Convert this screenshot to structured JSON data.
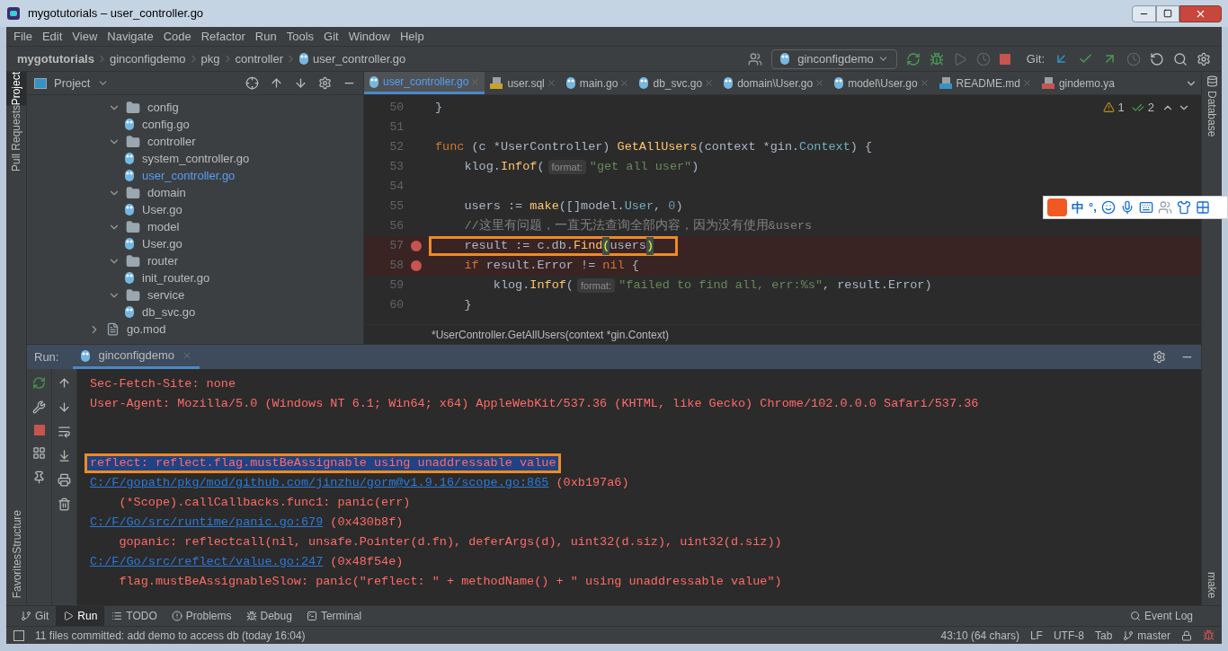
{
  "window": {
    "title": "mygotutorials – user_controller.go"
  },
  "menu": [
    "File",
    "Edit",
    "View",
    "Navigate",
    "Code",
    "Refactor",
    "Run",
    "Tools",
    "Git",
    "Window",
    "Help"
  ],
  "breadcrumb": [
    "mygotutorials",
    "ginconfigdemo",
    "pkg",
    "controller",
    "user_controller.go"
  ],
  "toolbar": {
    "run_config": "ginconfigdemo",
    "git_label": "Git:"
  },
  "left_strip": [
    {
      "label": "Project",
      "selected": true
    },
    {
      "label": "Pull Requests",
      "selected": false
    },
    {
      "label": "Structure",
      "selected": false
    },
    {
      "label": "Favorites",
      "selected": false
    }
  ],
  "project_panel": {
    "title": "Project",
    "tree": [
      {
        "label": "config",
        "kind": "folder",
        "expanded": true,
        "selected": false,
        "children": [
          {
            "label": "config.go",
            "kind": "go",
            "selected": false
          }
        ]
      },
      {
        "label": "controller",
        "kind": "folder",
        "expanded": true,
        "selected": false,
        "children": [
          {
            "label": "system_controller.go",
            "kind": "go",
            "selected": false
          },
          {
            "label": "user_controller.go",
            "kind": "go",
            "selected": true
          }
        ]
      },
      {
        "label": "domain",
        "kind": "folder",
        "expanded": true,
        "selected": false,
        "children": [
          {
            "label": "User.go",
            "kind": "go",
            "selected": false
          }
        ]
      },
      {
        "label": "model",
        "kind": "folder",
        "expanded": true,
        "selected": false,
        "children": [
          {
            "label": "User.go",
            "kind": "go",
            "selected": false
          }
        ]
      },
      {
        "label": "router",
        "kind": "folder",
        "expanded": true,
        "selected": false,
        "children": [
          {
            "label": "init_router.go",
            "kind": "go",
            "selected": false
          }
        ]
      },
      {
        "label": "service",
        "kind": "folder",
        "expanded": true,
        "selected": false,
        "children": [
          {
            "label": "db_svc.go",
            "kind": "go",
            "selected": false
          }
        ]
      },
      {
        "label": "go.mod",
        "kind": "mod",
        "expanded": false,
        "selected": false
      }
    ]
  },
  "editor_tabs": [
    {
      "label": "user_controller.go",
      "kind": "go",
      "selected": true
    },
    {
      "label": "user.sql",
      "kind": "sql",
      "selected": false
    },
    {
      "label": "main.go",
      "kind": "go",
      "selected": false
    },
    {
      "label": "db_svc.go",
      "kind": "go",
      "selected": false
    },
    {
      "label": "domain\\User.go",
      "kind": "go",
      "selected": false
    },
    {
      "label": "model\\User.go",
      "kind": "go",
      "selected": false
    },
    {
      "label": "README.md",
      "kind": "md",
      "selected": false
    },
    {
      "label": "gindemo.ya",
      "kind": "yml",
      "selected": false
    }
  ],
  "inspections": {
    "warnings": "1",
    "weak_warnings": "2"
  },
  "code_lines": [
    {
      "number": "50",
      "breakpoint": false,
      "annotated": false,
      "segments": [
        {
          "kind": "plain",
          "text": "}"
        }
      ]
    },
    {
      "number": "51",
      "breakpoint": false,
      "annotated": false
    },
    {
      "number": "52",
      "breakpoint": false,
      "annotated": false,
      "segments": [
        {
          "kind": "keyword",
          "text": "func "
        },
        {
          "kind": "plain",
          "text": "(c *UserController) "
        },
        {
          "kind": "func",
          "text": "GetAllUsers"
        },
        {
          "kind": "plain",
          "text": "(context *gin."
        },
        {
          "kind": "type",
          "text": "Context"
        },
        {
          "kind": "plain",
          "text": ") {"
        }
      ]
    },
    {
      "number": "53",
      "breakpoint": false,
      "annotated": false,
      "segments": [
        {
          "kind": "plain",
          "text": "    klog."
        },
        {
          "kind": "call",
          "text": "Infof"
        },
        {
          "kind": "plain",
          "text": "("
        },
        {
          "kind": "hint",
          "text": "format:"
        },
        {
          "kind": "string",
          "text": "\"get all user\""
        },
        {
          "kind": "plain",
          "text": ")"
        }
      ]
    },
    {
      "number": "54",
      "breakpoint": false,
      "annotated": false
    },
    {
      "number": "55",
      "breakpoint": false,
      "annotated": false,
      "segments": [
        {
          "kind": "plain",
          "text": "    users := "
        },
        {
          "kind": "func",
          "text": "make"
        },
        {
          "kind": "plain",
          "text": "([]model."
        },
        {
          "kind": "type",
          "text": "User"
        },
        {
          "kind": "plain",
          "text": ", "
        },
        {
          "kind": "number",
          "text": "0"
        },
        {
          "kind": "plain",
          "text": ")"
        }
      ]
    },
    {
      "number": "56",
      "breakpoint": false,
      "annotated": false,
      "segments": [
        {
          "kind": "comment",
          "text": "    //这里有问题，一直无法查询全部内容，因为没有使用&users"
        }
      ]
    },
    {
      "number": "57",
      "breakpoint": true,
      "annotated": true,
      "segments": [
        {
          "kind": "plain",
          "text": "    result := c.db."
        },
        {
          "kind": "call",
          "text": "Find"
        },
        {
          "kind": "paren",
          "text": "("
        },
        {
          "kind": "plain",
          "text": "users"
        },
        {
          "kind": "paren",
          "text": ")"
        }
      ]
    },
    {
      "number": "58",
      "breakpoint": true,
      "annotated": false,
      "segments": [
        {
          "kind": "keyword",
          "text": "    if "
        },
        {
          "kind": "plain",
          "text": "result.Error != "
        },
        {
          "kind": "keyword",
          "text": "nil"
        },
        {
          "kind": "plain",
          "text": " {"
        }
      ]
    },
    {
      "number": "59",
      "breakpoint": false,
      "annotated": false,
      "segments": [
        {
          "kind": "plain",
          "text": "        klog."
        },
        {
          "kind": "call",
          "text": "Infof"
        },
        {
          "kind": "plain",
          "text": "("
        },
        {
          "kind": "hint",
          "text": "format:"
        },
        {
          "kind": "string",
          "text": "\"failed to find all, err:%s\""
        },
        {
          "kind": "plain",
          "text": ", result.Error)"
        }
      ]
    },
    {
      "number": "60",
      "breakpoint": false,
      "annotated": false,
      "segments": [
        {
          "kind": "plain",
          "text": "    }"
        }
      ]
    }
  ],
  "editor_breadcrumb": "*UserController.GetAllUsers(context *gin.Context)",
  "right_strip": [
    "Database",
    "make"
  ],
  "ime_toolbar": {
    "mode": "中",
    "punctuation": "°,"
  },
  "run_panel": {
    "label": "Run:",
    "tab": "ginconfigdemo",
    "lines": [
      {
        "kind": "text",
        "text": "Sec-Fetch-Site: none",
        "selected": false,
        "annotated": false
      },
      {
        "kind": "text",
        "text": "User-Agent: Mozilla/5.0 (Windows NT 6.1; Win64; x64) AppleWebKit/537.36 (KHTML, like Gecko) Chrome/102.0.0.0 Safari/537.36",
        "selected": false,
        "annotated": false
      },
      {
        "kind": "blank",
        "selected": false,
        "annotated": false
      },
      {
        "kind": "blank",
        "selected": false,
        "annotated": false
      },
      {
        "kind": "text",
        "text": "reflect: reflect.flag.mustBeAssignable using unaddressable value",
        "selected": true,
        "annotated": true
      },
      {
        "kind": "link",
        "text": "C:/F/gopath/pkg/mod/github.com/jinzhu/gorm@v1.9.16/scope.go:865",
        "suffix": " (0xb197a6)",
        "selected": false,
        "annotated": false
      },
      {
        "kind": "text",
        "text": "    (*Scope).callCallbacks.func1: panic(err)",
        "selected": false,
        "annotated": false
      },
      {
        "kind": "link",
        "text": "C:/F/Go/src/runtime/panic.go:679",
        "suffix": " (0x430b8f)",
        "selected": false,
        "annotated": false
      },
      {
        "kind": "text",
        "text": "    gopanic: reflectcall(nil, unsafe.Pointer(d.fn), deferArgs(d), uint32(d.siz), uint32(d.siz))",
        "selected": false,
        "annotated": false
      },
      {
        "kind": "link",
        "text": "C:/F/Go/src/reflect/value.go:247",
        "suffix": " (0x48f54e)",
        "selected": false,
        "annotated": false
      },
      {
        "kind": "text",
        "text": "    flag.mustBeAssignableSlow: panic(\"reflect: \" + methodName() + \" using unaddressable value\")",
        "selected": false,
        "annotated": false
      }
    ]
  },
  "tool_tabs": [
    {
      "label": "Git",
      "kind": "git",
      "selected": false
    },
    {
      "label": "Run",
      "kind": "run",
      "selected": true
    },
    {
      "label": "TODO",
      "kind": "todo",
      "selected": false
    },
    {
      "label": "Problems",
      "kind": "problems",
      "selected": false
    },
    {
      "label": "Debug",
      "kind": "debug",
      "selected": false
    },
    {
      "label": "Terminal",
      "kind": "terminal",
      "selected": false
    }
  ],
  "event_log": "Event Log",
  "status": {
    "message": "11 files committed: add demo to access db (today 16:04)",
    "position": "43:10 (64 chars)",
    "line_separator": "LF",
    "encoding": "UTF-8",
    "indent": "Tab",
    "branch": "master"
  }
}
